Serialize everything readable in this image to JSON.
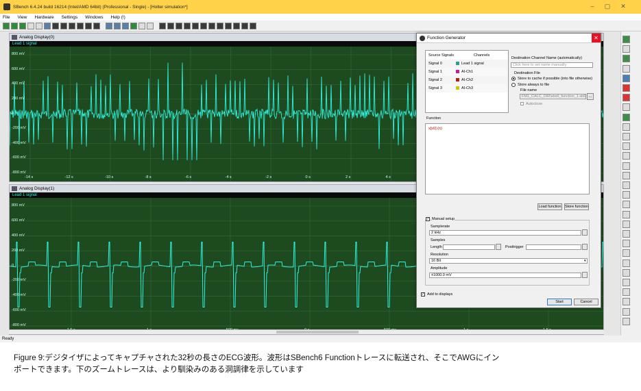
{
  "window": {
    "title": "SBench 6.4.24 build 16214 (Intel/AMD 64bit) (Professional - Single) - [Holter simulation*]",
    "minimize": "–",
    "maximize": "▢",
    "close": "✕"
  },
  "menu": [
    "File",
    "View",
    "Hardware",
    "Settings",
    "Windows",
    "Help (!)"
  ],
  "display1": {
    "title": "Analog Display(0)",
    "signal": "Lead 1 signal",
    "ylabels": [
      "800 mV",
      "600 mV",
      "400 mV",
      "200 mV",
      "0",
      "-200 mV",
      "-400 mV",
      "-600 mV",
      "-800 mV"
    ],
    "xlabels": [
      "-14 s",
      "-12 s",
      "-10 s",
      "-8 s",
      "-6 s",
      "-4 s",
      "-2 s",
      "0 s",
      "2 s",
      "4 s"
    ]
  },
  "display2": {
    "title": "Analog Display(1)",
    "signal": "Lead 1 signal",
    "ylabels": [
      "800 mV",
      "600 mV",
      "400 mV",
      "200 mV",
      "0",
      "-200 mV",
      "-400 mV",
      "-600 mV",
      "-800 mV"
    ],
    "xlabels": [
      "-1.5 s",
      "-1 s",
      "-500 ms",
      "0 s",
      "500 ms",
      "1 s",
      "1.5 s"
    ]
  },
  "status": "Ready",
  "dialog": {
    "title": "Function Generator",
    "close": "✕",
    "source_header": [
      "Source Signals",
      "Channels"
    ],
    "sources": [
      {
        "signal": "Signal 0",
        "channel": "Lead 1 signal",
        "color": "#2aa08a"
      },
      {
        "signal": "Signal 1",
        "channel": "AI-Ch1",
        "color": "#c0209a"
      },
      {
        "signal": "Signal 2",
        "channel": "AI-Ch2",
        "color": "#b02020"
      },
      {
        "signal": "Signal 3",
        "channel": "AI-Ch3",
        "color": "#c8c800"
      }
    ],
    "dest_label": "Destination Channel Name (automatically)",
    "dest_placeholder": "Click here to set name manually",
    "dest_file_label": "Destination File",
    "radio1": "Store to cache if possible (into file otherwise)",
    "radio2": "Store always to file",
    "file_name_label": "File name",
    "file_name_value": "FM1_CALC_DIR\\sbs6_function_1.sb6dat",
    "browse": "...",
    "autoclose": "Autoclose",
    "function_label": "Function",
    "function_value": "x[s0] (n)",
    "load_function": "Load function",
    "store_function": "Store function",
    "manual_setup": "Manual setup",
    "samplerate_label": "Samplerate",
    "samplerate_value": "2 kHz",
    "samples_label": "Samples",
    "length_label": "Length",
    "posttrigger_label": "Posttrigger",
    "resolution_label": "Resolution",
    "resolution_value": "16 Bit",
    "amplitude_label": "Amplitude",
    "amplitude_value": "±1000.0 mV",
    "add_to_displays": "Add to displays",
    "start": "Start",
    "cancel": "Cancel"
  },
  "caption": {
    "line1": "Figure 9:デジタイザによってキャプチャされた32秒の長さのECG波形。波形はSBench6 Functionトレースに転送され、そこでAWGにイン",
    "line2": "ポートできます。下のズームトレースは、より馴染みのある洞調律を示しています"
  },
  "colors": {
    "trace": "#2ef2e0",
    "plot_bg": "#1d4a1f",
    "titlebar": "#ffd24a"
  }
}
